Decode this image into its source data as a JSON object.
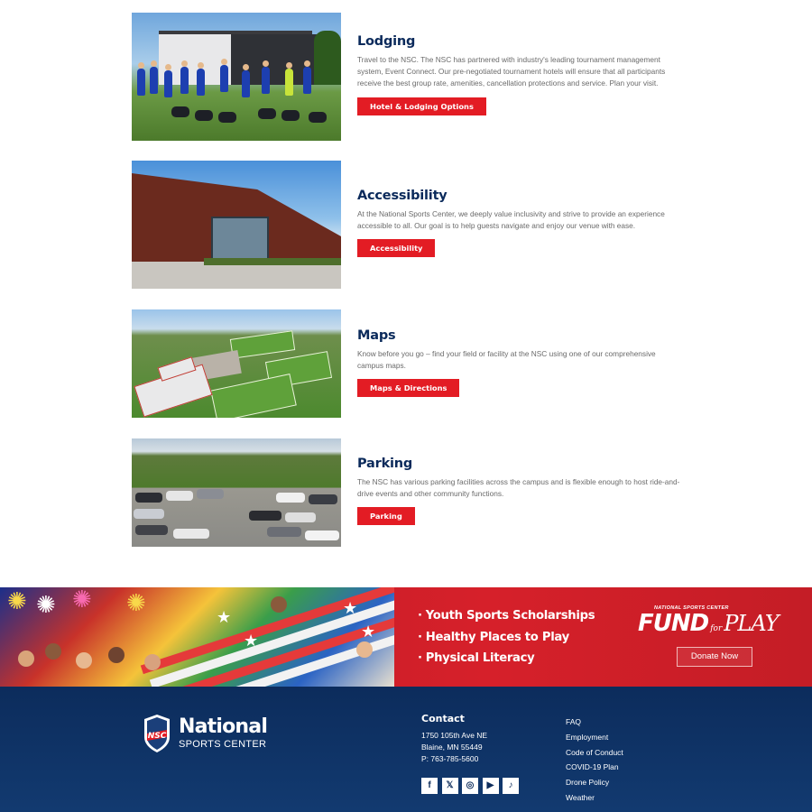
{
  "sections": [
    {
      "title": "Lodging",
      "body": "Travel to the NSC. The NSC has partnered with industry's leading tournament management system, Event Connect. Our pre-negotiated tournament hotels will ensure that all participants receive the best group rate, amenities, cancellation protections and service. Plan your visit.",
      "button": "Hotel & Lodging Options"
    },
    {
      "title": "Accessibility",
      "body": "At the National Sports Center, we deeply value inclusivity and strive to provide an experience accessible to all. Our goal is to help guests navigate and enjoy our venue with ease.",
      "button": "Accessibility"
    },
    {
      "title": "Maps",
      "body": "Know before you go – find your field or facility at the NSC using one of our comprehensive campus maps.",
      "button": "Maps & Directions"
    },
    {
      "title": "Parking",
      "body": "The NSC has various parking facilities across the campus and is flexible enough to host ride-and-drive events and other community functions.",
      "button": "Parking"
    }
  ],
  "banner": {
    "bullets": [
      "Youth Sports Scholarships",
      "Healthy Places to Play",
      "Physical Literacy"
    ],
    "bullet_char": "·",
    "fund_small": "NATIONAL SPORTS CENTER",
    "fund_big": "FUND",
    "fund_for": "for",
    "fund_play": "PLAY",
    "donate": "Donate Now"
  },
  "footer": {
    "logo_shield_text": "NSC",
    "logo_name": "National",
    "logo_sub": "SPORTS CENTER",
    "contact_title": "Contact",
    "address1": "1750 105th Ave NE",
    "address2": "Blaine, MN 55449",
    "phone": "P: 763-785-5600",
    "socials": [
      {
        "icon": "facebook-icon",
        "glyph": "f"
      },
      {
        "icon": "x-icon",
        "glyph": "𝕏"
      },
      {
        "icon": "instagram-icon",
        "glyph": "◎"
      },
      {
        "icon": "youtube-icon",
        "glyph": "▶"
      },
      {
        "icon": "tiktok-icon",
        "glyph": "♪"
      }
    ],
    "links": [
      "FAQ",
      "Employment",
      "Code of Conduct",
      "COVID-19 Plan",
      "Drone Policy",
      "Weather"
    ]
  },
  "colors": {
    "navy": "#0b2a5b",
    "red": "#e31c24",
    "footer_bg": "#0c2c5c"
  }
}
